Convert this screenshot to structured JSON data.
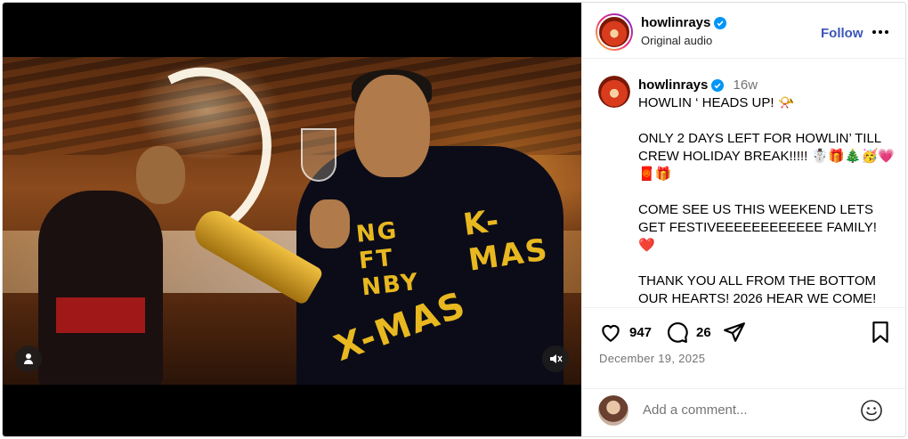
{
  "header": {
    "username": "howlinrays",
    "subtitle": "Original audio",
    "follow_label": "Follow"
  },
  "caption": {
    "username": "howlinrays",
    "time": "16w",
    "text": "HOWLIN ‘ HEADS UP! 📯\n\nONLY 2 DAYS LEFT FOR HOWLIN’ TILL CREW HOLIDAY BREAK!!!!! ☃️🎁🎄🥳💗🧧🎁\n\nCOME SEE US THIS WEEKEND LETS GET FESTIVEEEEEEEEEEEE FAMILY! ❤️\n\nTHANK YOU ALL FROM THE BOTTOM OUR HEARTS! 2026 HEAR WE COME!"
  },
  "actions": {
    "likes": "947",
    "comments": "26",
    "date": "December 19, 2025"
  },
  "comment": {
    "placeholder": "Add a comment..."
  },
  "media": {
    "sweater_text_1": "K-MAS",
    "sweater_text_2": "X-MAS",
    "sweater_text_3": "NG FT NBY"
  },
  "colors": {
    "follow": "#3b55b8",
    "verified": "#0095f6",
    "secondary_text": "#737373"
  },
  "icons": [
    "person-tag-icon",
    "mute-icon",
    "verified-icon",
    "more-icon",
    "heart-icon",
    "comment-icon",
    "share-icon",
    "bookmark-icon",
    "emoji-icon"
  ]
}
